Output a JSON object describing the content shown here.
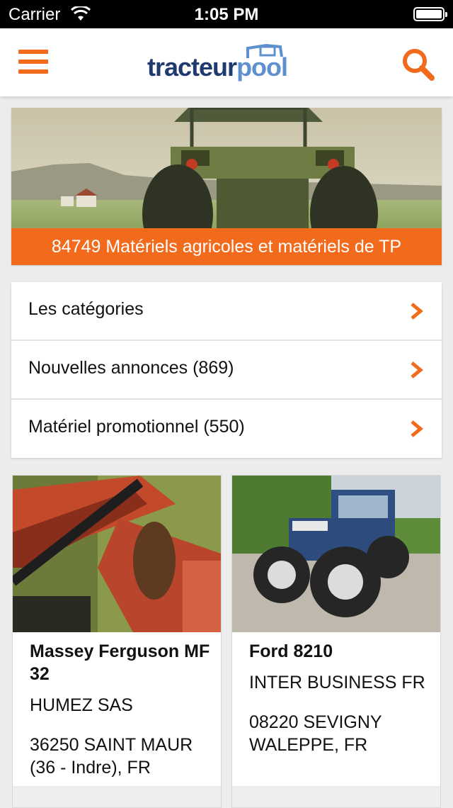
{
  "status_bar": {
    "carrier": "Carrier",
    "time": "1:05 PM",
    "wifi_icon": "wifi-icon",
    "battery_icon": "battery-icon"
  },
  "header": {
    "menu_icon": "hamburger-menu-icon",
    "logo_part1": "tracteur",
    "logo_part2": "pool",
    "search_icon": "search-icon",
    "accent_color": "#f26a1b"
  },
  "hero": {
    "banner_text": "84749 Matériels agricoles et matériels de TP"
  },
  "menu": {
    "items": [
      {
        "label": "Les catégories"
      },
      {
        "label": "Nouvelles annonces (869)"
      },
      {
        "label": "Matériel promotionnel (550)"
      }
    ]
  },
  "listings": [
    {
      "title": "Massey Ferguson MF 32",
      "dealer": "HUMEZ SAS",
      "location": "36250 SAINT MAUR (36 - Indre), FR"
    },
    {
      "title": "Ford 8210",
      "dealer": "INTER BUSINESS FR",
      "location": "08220 SEVIGNY WALEPPE, FR"
    }
  ]
}
